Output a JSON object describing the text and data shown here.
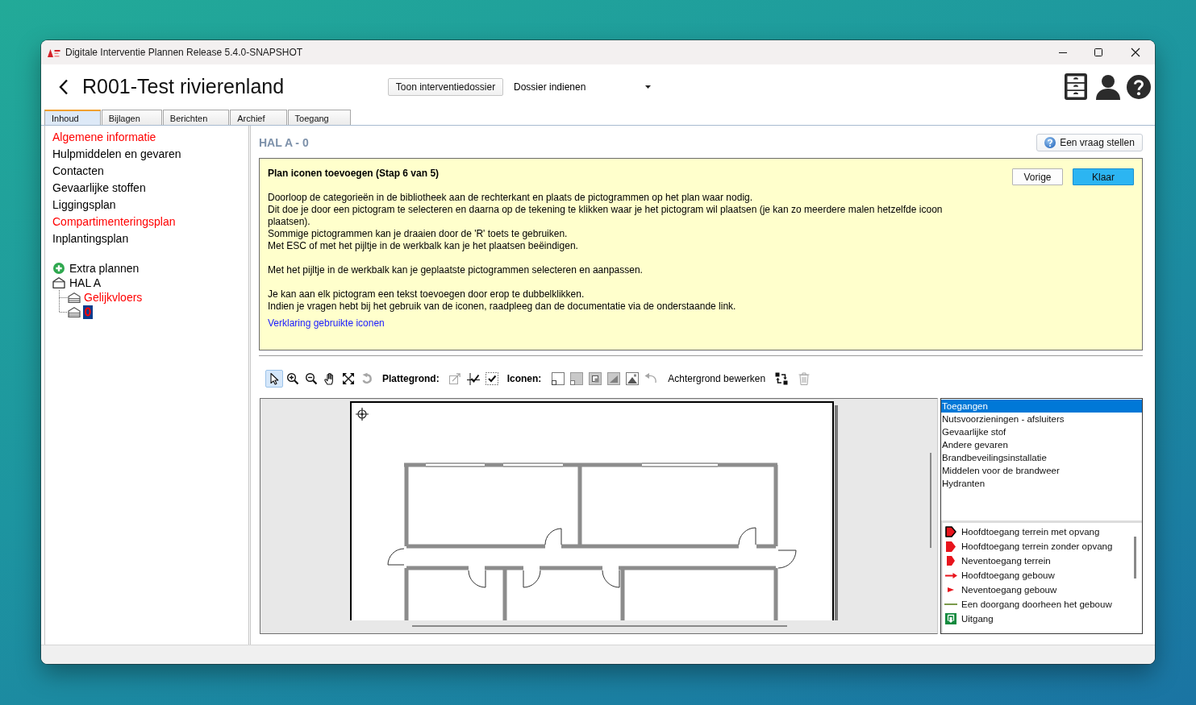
{
  "window": {
    "title": "Digitale Interventie Plannen Release 5.4.0-SNAPSHOT"
  },
  "header": {
    "title": "R001-Test rivierenland",
    "dossier_button": "Toon interventiedossier",
    "action_dropdown": {
      "value": "Dossier indienen"
    }
  },
  "tabs": [
    {
      "label": "Inhoud",
      "selected": true
    },
    {
      "label": "Bijlagen",
      "selected": false
    },
    {
      "label": "Berichten",
      "selected": false
    },
    {
      "label": "Archief",
      "selected": false
    },
    {
      "label": "Toegang",
      "selected": false
    }
  ],
  "sidebar": {
    "items": [
      {
        "label": "Algemene informatie",
        "color": "#ff0000"
      },
      {
        "label": "Hulpmiddelen en gevaren",
        "color": "#000000"
      },
      {
        "label": "Contacten",
        "color": "#000000"
      },
      {
        "label": "Gevaarlijke stoffen",
        "color": "#000000"
      },
      {
        "label": "Liggingsplan",
        "color": "#000000"
      },
      {
        "label": "Compartimenteringsplan",
        "color": "#ff0000"
      },
      {
        "label": "Inplantingsplan",
        "color": "#000000"
      }
    ],
    "extra_plans": "Extra plannen",
    "tree": [
      {
        "label": "HAL A",
        "selected": false,
        "color": "#000000",
        "children": [
          {
            "label": "Gelijkvloers",
            "selected": false,
            "color": "#ff0000"
          },
          {
            "label": "0",
            "selected": true,
            "color": "#ff0000"
          }
        ]
      }
    ]
  },
  "plan": {
    "heading": "HAL A - 0",
    "ask_button": "Een vraag stellen",
    "instructions": {
      "title": "Plan iconen toevoegen (Stap 6 van 5)",
      "paragraphs": [
        [
          "Doorloop de categorieën in de bibliotheek aan de rechterkant en plaats de pictogrammen op het plan waar nodig.",
          "Dit doe je door een pictogram te selecteren en daarna op de tekening te klikken waar je het pictogram wil plaatsen (je kan zo meerdere malen hetzelfde icoon plaatsen).",
          "Sommige pictogrammen kan je draaien door de 'R' toets te gebruiken.",
          "Met ESC of met het pijltje in de werkbalk kan je het plaatsen beëindigen."
        ],
        [
          "Met het pijltje in de werkbalk kan je geplaatste pictogrammen selecteren en aanpassen."
        ],
        [
          "Je kan aan elk pictogram een tekst toevoegen door erop te dubbelklikken.",
          "Indien je vragen hebt bij het gebruik van de iconen, raadpleeg dan de documentatie via de onderstaande link."
        ]
      ],
      "link": "Verklaring gebruikte iconen",
      "buttons": [
        {
          "label": "Vorige",
          "primary": false
        },
        {
          "label": "Klaar",
          "primary": true
        }
      ]
    },
    "toolbar": {
      "tools": [
        {
          "selected": true,
          "disabled": false
        },
        {
          "selected": false,
          "disabled": false
        },
        {
          "selected": false,
          "disabled": false
        },
        {
          "selected": false,
          "disabled": false
        },
        {
          "selected": false,
          "disabled": false
        },
        {
          "selected": false,
          "disabled": true
        }
      ],
      "plan_label": "Plattegrond:",
      "plan_tools": [
        {
          "disabled": true
        },
        {
          "disabled": false
        },
        {
          "disabled": false
        }
      ],
      "icons_label": "Iconen:",
      "undo_tool": {
        "disabled": true
      },
      "background_button": "Achtergrond bewerken",
      "delete_tool": {
        "disabled": true
      }
    },
    "library": {
      "categories": [
        {
          "label": "Toegangen",
          "selected": true
        },
        {
          "label": "Nutsvoorzieningen - afsluiters",
          "selected": false
        },
        {
          "label": "Gevaarlijke stof",
          "selected": false
        },
        {
          "label": "Andere gevaren",
          "selected": false
        },
        {
          "label": "Brandbeveilingsinstallatie",
          "selected": false
        },
        {
          "label": "Middelen voor de brandweer",
          "selected": false
        },
        {
          "label": "Hydranten",
          "selected": false
        }
      ],
      "icons": [
        "Hoofdtoegang terrein met opvang",
        "Hoofdtoegang terrein zonder opvang",
        "Neventoegang terrein",
        "Hoofdtoegang gebouw",
        "Neventoegang gebouw",
        "Een doorgang doorheen het gebouw",
        "Uitgang"
      ]
    }
  }
}
